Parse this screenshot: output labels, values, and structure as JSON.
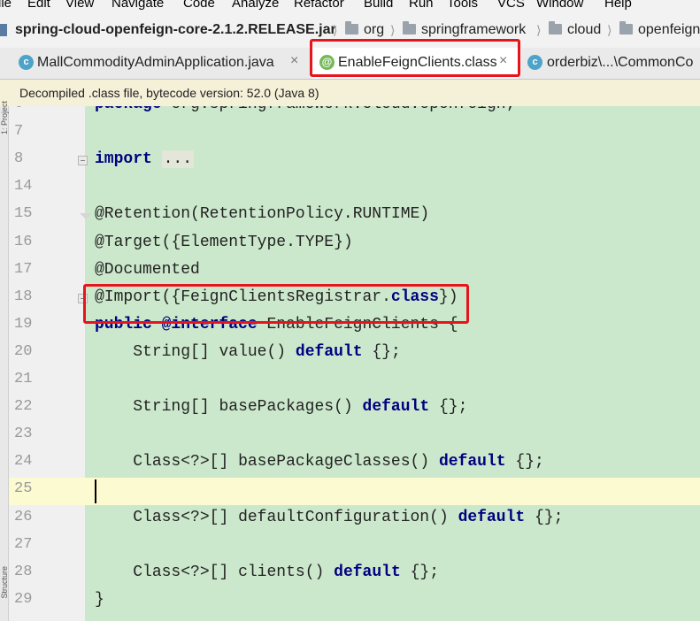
{
  "menu": [
    "ile",
    "Edit",
    "View",
    "Navigate",
    "Code",
    "Analyze",
    "Refactor",
    "Build",
    "Run",
    "Tools",
    "VCS",
    "Window",
    "Help"
  ],
  "breadcrumb": {
    "jar": "spring-cloud-openfeign-core-2.1.2.RELEASE.jar",
    "parts": [
      "org",
      "springframework",
      "cloud",
      "openfeign"
    ]
  },
  "tabs": [
    {
      "label": "MallCommodityAdminApplication.java",
      "icon": "class-c-icon",
      "close": "×"
    },
    {
      "label": "EnableFeignClients.class",
      "icon": "annotation-icon",
      "close": "×"
    },
    {
      "label": "orderbiz\\...\\CommonCo",
      "icon": "class-c-icon",
      "close": ""
    }
  ],
  "icon_glyphs": {
    "class": "c",
    "annotation": "@"
  },
  "infobar": "Decompiled .class file, bytecode version: 52.0 (Java 8)",
  "toolstrip": {
    "top": "1: Project",
    "bottom": "Structure"
  },
  "code_lines": [
    {
      "num": "6",
      "code": "package org.springframework.cloud.openfeign;"
    },
    {
      "num": "7",
      "code": ""
    },
    {
      "num": "8",
      "code": "import ..."
    },
    {
      "num": "14",
      "code": ""
    },
    {
      "num": "15",
      "code": "@Retention(RetentionPolicy.RUNTIME)"
    },
    {
      "num": "16",
      "code": "@Target({ElementType.TYPE})"
    },
    {
      "num": "17",
      "code": "@Documented"
    },
    {
      "num": "18",
      "code": "@Import({FeignClientsRegistrar.class})"
    },
    {
      "num": "19",
      "code": "public @interface EnableFeignClients {"
    },
    {
      "num": "20",
      "code": "    String[] value() default {};"
    },
    {
      "num": "21",
      "code": ""
    },
    {
      "num": "22",
      "code": "    String[] basePackages() default {};"
    },
    {
      "num": "23",
      "code": ""
    },
    {
      "num": "24",
      "code": "    Class<?>[] basePackageClasses() default {};"
    },
    {
      "num": "25",
      "code": ""
    },
    {
      "num": "26",
      "code": "    Class<?>[] defaultConfiguration() default {};"
    },
    {
      "num": "27",
      "code": ""
    },
    {
      "num": "28",
      "code": "    Class<?>[] clients() default {};"
    },
    {
      "num": "29",
      "code": "}"
    }
  ],
  "colors": {
    "code_background": "#cce8cc",
    "keyword": "#000080",
    "caret_line": "#fcfad0",
    "highlight_box": "#e8141c"
  }
}
